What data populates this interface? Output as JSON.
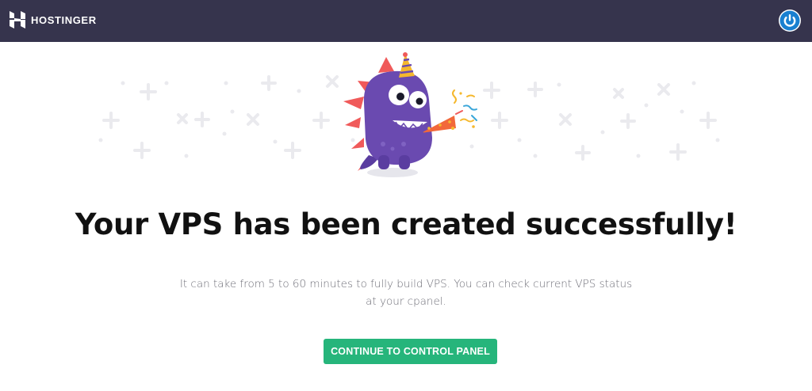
{
  "header": {
    "brand_name": "HOSTINGER",
    "brand_icon": "hostinger-logo-icon",
    "power_icon": "power-icon",
    "colors": {
      "background": "#36344d",
      "power_ring": "#1a80d0"
    }
  },
  "illustration": {
    "name": "party-monster-illustration",
    "colors": {
      "body": "#6a4ab0",
      "spikes": "#f05a5a",
      "horn": "#f2683a",
      "confetti": "#f5b82e"
    }
  },
  "main": {
    "headline": "Your VPS has been created successfully!",
    "description_line1": "It can take from 5 to 60 minutes to fully build VPS. You can check current VPS status",
    "description_line2": "at your cpanel.",
    "cta_label": "CONTINUE TO CONTROL PANEL",
    "colors": {
      "cta": "#26b57b",
      "headline": "#111111",
      "description": "#6f6f78"
    }
  }
}
